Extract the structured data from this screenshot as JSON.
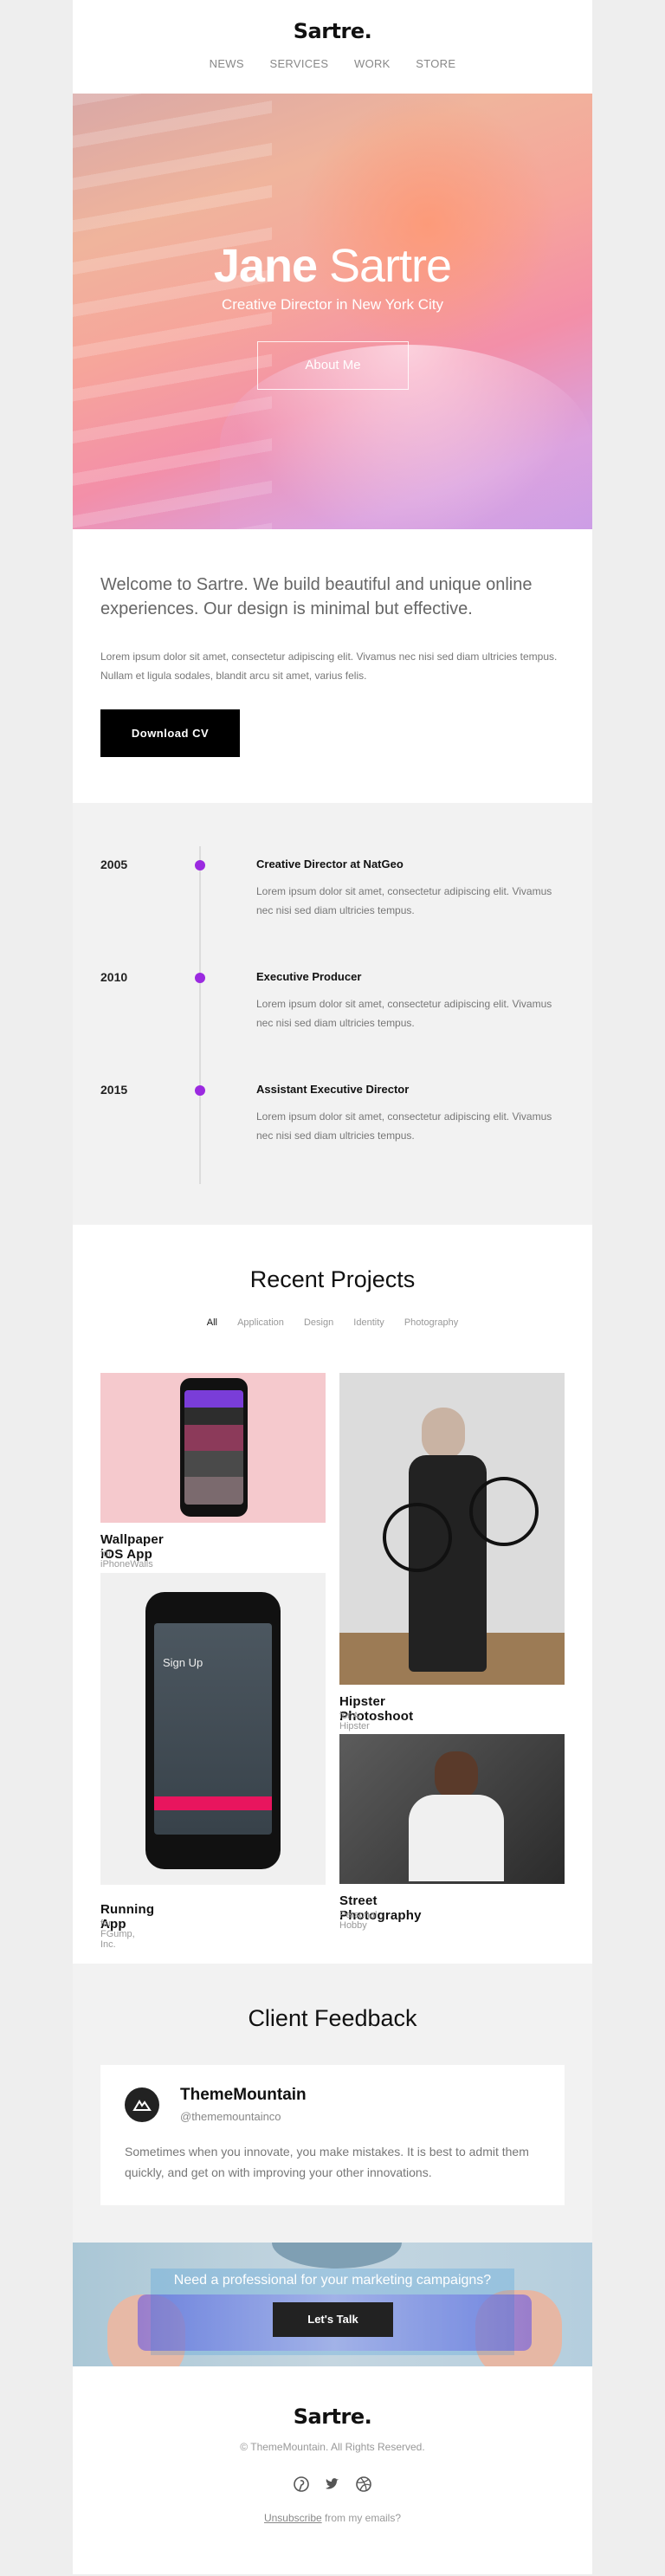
{
  "brand": "Sartre.",
  "nav": [
    "NEWS",
    "SERVICES",
    "WORK",
    "STORE"
  ],
  "hero": {
    "first_name": "Jane",
    "last_name": "Sartre",
    "subtitle": "Creative Director in New York City",
    "button": "About Me"
  },
  "intro": {
    "headline": "Welcome to Sartre. We build beautiful and unique online experiences. Our design is minimal but effective.",
    "body": "Lorem ipsum dolor sit amet, consectetur adipiscing elit. Vivamus nec nisi sed diam ultricies tempus. Nullam et ligula sodales, blandit arcu sit amet, varius felis.",
    "button": "Download CV"
  },
  "timeline": [
    {
      "year": "2005",
      "title": "Creative Director at NatGeo",
      "desc": "Lorem ipsum dolor sit amet, consectetur adipiscing elit. Vivamus nec nisi sed diam ultricies tempus."
    },
    {
      "year": "2010",
      "title": "Executive Producer",
      "desc": "Lorem ipsum dolor sit amet, consectetur adipiscing elit. Vivamus nec nisi sed diam ultricies tempus."
    },
    {
      "year": "2015",
      "title": "Assistant Executive Director",
      "desc": "Lorem ipsum dolor sit amet, consectetur adipiscing elit. Vivamus nec nisi sed diam ultricies tempus."
    }
  ],
  "projects": {
    "title": "Recent Projects",
    "filters": [
      "All",
      "Application",
      "Design",
      "Identity",
      "Photography"
    ],
    "active_filter": "All",
    "items": [
      {
        "title": "Wallpaper iOS App",
        "subtitle": "for iPhoneWalls"
      },
      {
        "title": "Running App",
        "subtitle": "for FGump, Inc."
      },
      {
        "title": "Hipster Photoshoot",
        "subtitle": "for A Hipster"
      },
      {
        "title": "Street Photography",
        "subtitle": "Personal Hobby"
      }
    ],
    "phone_screen_text": "Sign Up"
  },
  "feedback": {
    "title": "Client Feedback",
    "name": "ThemeMountain",
    "handle": "@thememountainco",
    "text": "Sometimes when you innovate, you make mistakes. It is best to admit them quickly, and get on with improving your other innovations."
  },
  "cta": {
    "question": "Need a professional for your marketing campaigns?",
    "button": "Let's Talk"
  },
  "footer": {
    "brand": "Sartre.",
    "copyright": "© ThemeMountain. All Rights Reserved.",
    "social_icons": [
      "pinterest-icon",
      "twitter-icon",
      "dribbble-icon"
    ],
    "unsubscribe_link": "Unsubscribe",
    "unsubscribe_suffix": " from my emails?"
  },
  "colors": {
    "accent": "#9b2ae0",
    "button_dark": "#000000",
    "background": "#eeeeee"
  }
}
